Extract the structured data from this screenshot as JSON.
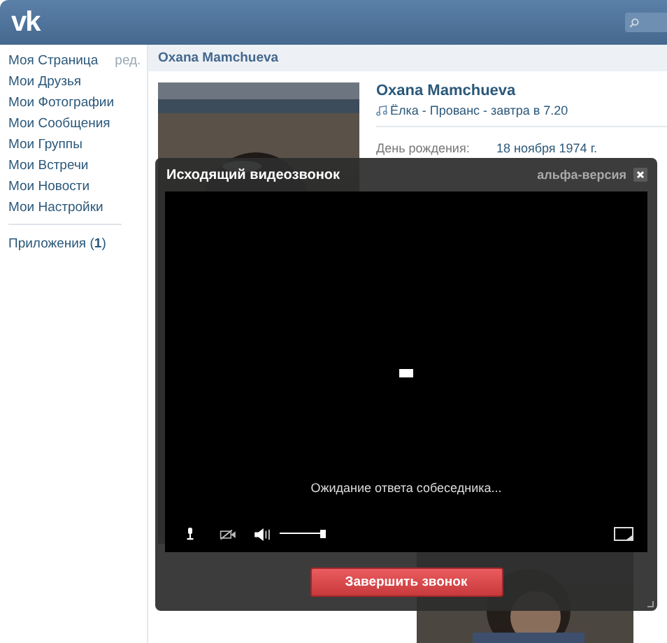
{
  "header": {
    "logo": "vk"
  },
  "sidebar": {
    "items": [
      {
        "label": "Моя Страница",
        "edit": "ред."
      },
      {
        "label": "Мои Друзья"
      },
      {
        "label": "Мои Фотографии"
      },
      {
        "label": "Мои Сообщения"
      },
      {
        "label": "Мои Группы"
      },
      {
        "label": "Мои Встречи"
      },
      {
        "label": "Мои Новости"
      },
      {
        "label": "Мои Настройки"
      }
    ],
    "apps": "Приложения (**1**)"
  },
  "profile": {
    "page_title": "Oxana Mamchueva",
    "name": "Oxana Mamchueva",
    "status": "Ёлка - Прованс - завтра в 7.20",
    "fields": [
      {
        "label": "День рождения:",
        "value": "18 ноября 1974 г."
      }
    ]
  },
  "call": {
    "title": "Исходящий видеозвонок",
    "badge": "альфа-версия",
    "status": "Ожидание ответа собеседника...",
    "volume": {
      "level": 0.85
    },
    "end_button": "Завершить звонок"
  }
}
